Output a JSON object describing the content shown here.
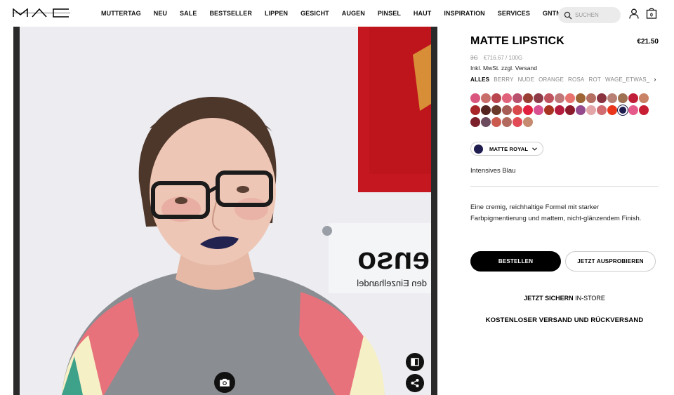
{
  "header": {
    "logo_text": "M·A·C",
    "nav": [
      "MUTTERTAG",
      "NEU",
      "SALE",
      "BESTSELLER",
      "LIPPEN",
      "GESICHT",
      "AUGEN",
      "PINSEL",
      "HAUT",
      "INSPIRATION",
      "SERVICES",
      "GNTM"
    ],
    "search_placeholder": "SUCHEN",
    "bag_count": "0"
  },
  "camera": {
    "sign_text": "enso",
    "sign_subtext": "den Einzelhandel",
    "icons": [
      "camera-icon",
      "split-view-icon",
      "share-icon"
    ]
  },
  "product": {
    "title": "MATTE LIPSTICK",
    "price": "€21.50",
    "size": "3G",
    "unit_price": "€716.67 / 100G",
    "tax_note": "Inkl. MwSt. zzgl. Versand",
    "filters": [
      "ALLES",
      "BERRY",
      "NUDE",
      "ORANGE",
      "ROSA",
      "ROT",
      "WAGE_ETWAS_"
    ],
    "active_filter": "ALLES",
    "swatches": [
      "#d9577e",
      "#c86e6a",
      "#b9464f",
      "#e1627b",
      "#b9506d",
      "#9a3e33",
      "#8f3a47",
      "#c0545e",
      "#c07778",
      "#e8736e",
      "#9d6435",
      "#b46f62",
      "#8a3340",
      "#b88074",
      "#9d7152",
      "#c01e38",
      "#c98265",
      "#a8252a",
      "#53231f",
      "#6a3a2a",
      "#a65d56",
      "#d8494c",
      "#e11f3e",
      "#d8508f",
      "#a73321",
      "#b31c3c",
      "#8b1a2b",
      "#944b8d",
      "#e3a6a8",
      "#cf6d70",
      "#e9361a",
      "#1f1c4f",
      "#e55a8b",
      "#c71e34",
      "#7b1f2b",
      "#6b4a5e",
      "#cb5b4f",
      "#b26a5e",
      "#e14b55",
      "#c58a6f"
    ],
    "selected_swatch_index": 31,
    "shade_name": "MATTE ROYAL",
    "shade_color": "#1f1c4f",
    "shade_description": "Intensives Blau",
    "description": "Eine cremig, reichhaltige Formel mit starker Farbpigmentierung und mattem, nicht-glänzendem Finish.",
    "buy_label": "BESTELLEN",
    "try_label": "JETZT AUSPROBIEREN",
    "instore_bold": "JETZT SICHERN",
    "instore_rest": "IN-STORE",
    "shipping_note": "KOSTENLOSER VERSAND UND RÜCKVERSAND"
  }
}
